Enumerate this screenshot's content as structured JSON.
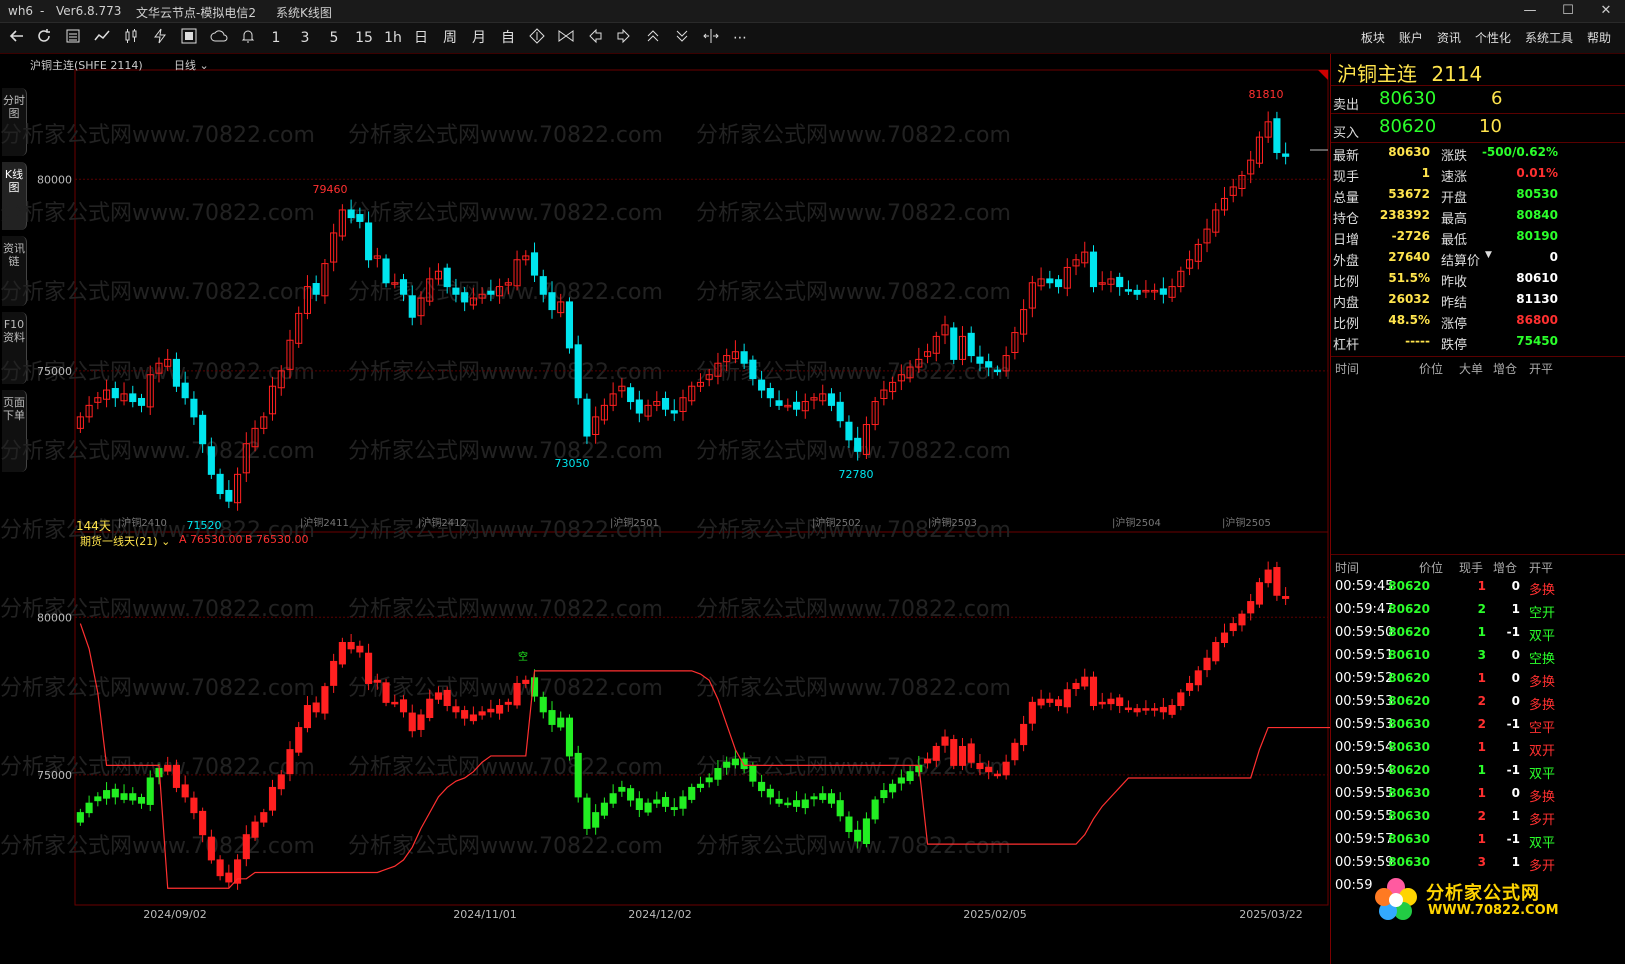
{
  "titlebar": {
    "app": "wh6",
    "version": "Ver6.8.773",
    "server": "文华云节点-模拟电信2",
    "view": "系统K线图",
    "controls": [
      "—",
      "☐",
      "✕"
    ]
  },
  "toolbar": {
    "icons": [
      "back-icon",
      "refresh-icon",
      "list-icon",
      "line-chart-icon",
      "candle-icon",
      "lightning-icon",
      "grid-icon",
      "cloud-icon",
      "bell-icon"
    ],
    "periods": [
      "1",
      "3",
      "5",
      "15",
      "1h",
      "日",
      "周",
      "月",
      "自"
    ],
    "menu": [
      "板块",
      "账户",
      "资讯",
      "个性化",
      "系统工具",
      "帮助"
    ]
  },
  "lefttabs": [
    {
      "label": "分时图",
      "active": false
    },
    {
      "label": "K线图",
      "active": true
    },
    {
      "label": "资讯链",
      "active": false
    },
    {
      "label": "F10资料",
      "active": false
    },
    {
      "label": "页面下单",
      "active": false
    }
  ],
  "chart": {
    "symbol_label": "沪铜主连(SHFE 2114)",
    "period_label": "日线",
    "days_label": "144天",
    "indicator_label": "期货一线天(21)",
    "indicator_a": "A 76530.00",
    "indicator_b": "B 76530.00",
    "watermark": "分析家公式网www.70822.com",
    "signal_label": "空",
    "colors": {
      "up": "#ff2020",
      "down": "#00e5ee",
      "ind_up": "#ff2020",
      "ind_down": "#22ee22",
      "line": "#ff3030",
      "grid": "#5a0000"
    }
  },
  "chart_data": [
    {
      "type": "candlestick",
      "title": "沪铜主连(SHFE 2114) 日线",
      "y_ticks": [
        80000,
        75000
      ],
      "ylim": [
        70900,
        82800
      ],
      "x_ticks": [
        "2024/09/02",
        "2024/11/01",
        "2024/12/02",
        "2025/02/05",
        "2025/03/22"
      ],
      "contract_labels": [
        "沪铜2410",
        "沪铜2411",
        "沪铜2412",
        "沪铜2501",
        "沪铜2502",
        "沪铜2503",
        "沪铜2504",
        "沪铜2505"
      ],
      "annotations": [
        "81810",
        "79460",
        "73050",
        "72780",
        "71520"
      ],
      "close_path": [
        73800,
        74100,
        74300,
        74500,
        74300,
        74400,
        74200,
        74100,
        74900,
        75200,
        75300,
        74600,
        74300,
        73800,
        73100,
        72300,
        71800,
        71600,
        72300,
        73100,
        73500,
        73800,
        74600,
        75000,
        75800,
        76500,
        77200,
        77000,
        77800,
        78600,
        79200,
        79000,
        78900,
        77900,
        78000,
        77300,
        77300,
        77000,
        76400,
        76900,
        77400,
        77600,
        77200,
        77000,
        76800,
        76900,
        77000,
        77000,
        77200,
        77300,
        77900,
        78000,
        77500,
        77000,
        76600,
        76800,
        75600,
        74300,
        73300,
        73800,
        74100,
        74400,
        74600,
        74200,
        73900,
        74100,
        74200,
        74000,
        73900,
        74300,
        74600,
        74700,
        74900,
        75200,
        75400,
        75500,
        75200,
        74800,
        74500,
        74300,
        74100,
        74100,
        74000,
        74200,
        74300,
        74400,
        74100,
        73700,
        73200,
        72900,
        73600,
        74200,
        74500,
        74700,
        74900,
        75100,
        75300,
        75500,
        75900,
        76200,
        75300,
        75900,
        75400,
        75200,
        75100,
        75000,
        75400,
        76000,
        76600,
        77300,
        77400,
        77300,
        77200,
        77700,
        77900,
        78100,
        77200,
        77300,
        77400,
        77200,
        77100,
        77000,
        77100,
        77100,
        77000,
        77200,
        77600,
        77900,
        78300,
        78700,
        79200,
        79500,
        79800,
        80100,
        80500,
        81100,
        81500,
        80700,
        80600
      ],
      "indicator": {
        "name": "期货一线天(21)",
        "A": 76530.0,
        "B": 76530.0,
        "line_path": [
          79800,
          79000,
          77600,
          75300,
          75300,
          75300,
          75300,
          75300,
          75300,
          75300,
          71400,
          71400,
          71400,
          71400,
          71400,
          71400,
          71400,
          71400,
          71700,
          71700,
          71900,
          71900,
          71900,
          71900,
          71900,
          71900,
          71900,
          71900,
          71900,
          71900,
          71900,
          71900,
          71900,
          71900,
          71900,
          72000,
          72100,
          72300,
          72700,
          73300,
          73800,
          74300,
          74600,
          74800,
          74900,
          75100,
          75400,
          75600,
          75600,
          75600,
          75600,
          75600,
          78300,
          78300,
          78300,
          78300,
          78300,
          78300,
          78300,
          78300,
          78300,
          78300,
          78300,
          78300,
          78300,
          78300,
          78300,
          78300,
          78300,
          78300,
          78300,
          78200,
          78000,
          77400,
          76600,
          75800,
          75300,
          75300,
          75300,
          75300,
          75300,
          75300,
          75300,
          75300,
          75300,
          75300,
          75300,
          75300,
          75300,
          75300,
          75300,
          75300,
          75300,
          75300,
          75300,
          75300,
          75300,
          72800,
          72800,
          72800,
          72800,
          72800,
          72800,
          72800,
          72800,
          72800,
          72800,
          72800,
          72800,
          72800,
          72800,
          72800,
          72800,
          72800,
          72800,
          73100,
          73600,
          74000,
          74300,
          74600,
          74900,
          74900,
          74900,
          74900,
          74900,
          74900,
          74900,
          74900,
          74900,
          74900,
          74900,
          74900,
          74900,
          74900,
          74900,
          75800,
          76500,
          76500,
          76500,
          76500,
          76500,
          76500,
          76500,
          76500,
          76500,
          76500,
          76500,
          76500
        ]
      }
    }
  ],
  "panel": {
    "name": "沪铜主连",
    "code": "2114",
    "sell_label": "卖出",
    "sell_price": "80630",
    "sell_vol": "6",
    "buy_label": "买入",
    "buy_price": "80620",
    "buy_vol": "10",
    "quotes": [
      {
        "l1": "最新",
        "v1": "80630",
        "c1": "yel",
        "l2": "涨跌",
        "v2": "-500/0.62%",
        "c2": "grn"
      },
      {
        "l1": "现手",
        "v1": "1",
        "c1": "yel",
        "l2": "速涨",
        "v2": "0.01%",
        "c2": "red"
      },
      {
        "l1": "总量",
        "v1": "53672",
        "c1": "yel",
        "l2": "开盘",
        "v2": "80530",
        "c2": "grn"
      },
      {
        "l1": "持仓",
        "v1": "238392",
        "c1": "yel",
        "l2": "最高",
        "v2": "80840",
        "c2": "grn"
      },
      {
        "l1": "日增",
        "v1": "-2726",
        "c1": "yel",
        "l2": "最低",
        "v2": "80190",
        "c2": "grn"
      },
      {
        "l1": "外盘",
        "v1": "27640",
        "c1": "yel",
        "l2": "结算价",
        "v2": "0",
        "c2": "wht"
      },
      {
        "l1": "比例",
        "v1": "51.5%",
        "c1": "yel",
        "l2": "昨收",
        "v2": "80610",
        "c2": "wht"
      },
      {
        "l1": "内盘",
        "v1": "26032",
        "c1": "yel",
        "l2": "昨结",
        "v2": "81130",
        "c2": "wht"
      },
      {
        "l1": "比例",
        "v1": "48.5%",
        "c1": "yel",
        "l2": "涨停",
        "v2": "86800",
        "c2": "red"
      },
      {
        "l1": "杠杆",
        "v1": "-----",
        "c1": "yel",
        "l2": "跌停",
        "v2": "75450",
        "c2": "grn"
      }
    ],
    "bigorder_headers": [
      "时间",
      "价位",
      "大单",
      "增仓",
      "开平"
    ],
    "tick_headers": [
      "时间",
      "价位",
      "现手",
      "增仓",
      "开平"
    ],
    "ticks": [
      {
        "time": "00:59:45",
        "price": "80620",
        "vol": "1",
        "vc": "red",
        "chg": "0",
        "type": "多换",
        "tc": "red"
      },
      {
        "time": "00:59:47",
        "price": "80620",
        "vol": "2",
        "vc": "grn",
        "chg": "1",
        "type": "空开",
        "tc": "grn"
      },
      {
        "time": "00:59:50",
        "price": "80620",
        "vol": "1",
        "vc": "grn",
        "chg": "-1",
        "type": "双平",
        "tc": "grn"
      },
      {
        "time": "00:59:51",
        "price": "80610",
        "vol": "3",
        "vc": "grn",
        "chg": "0",
        "type": "空换",
        "tc": "grn"
      },
      {
        "time": "00:59:52",
        "price": "80620",
        "vol": "1",
        "vc": "red",
        "chg": "0",
        "type": "多换",
        "tc": "red"
      },
      {
        "time": "00:59:53",
        "price": "80620",
        "vol": "2",
        "vc": "red",
        "chg": "0",
        "type": "多换",
        "tc": "red"
      },
      {
        "time": "00:59:53",
        "price": "80630",
        "vol": "2",
        "vc": "red",
        "chg": "-1",
        "type": "空平",
        "tc": "red"
      },
      {
        "time": "00:59:54",
        "price": "80630",
        "vol": "1",
        "vc": "red",
        "chg": "1",
        "type": "双开",
        "tc": "red"
      },
      {
        "time": "00:59:54",
        "price": "80620",
        "vol": "1",
        "vc": "grn",
        "chg": "-1",
        "type": "双平",
        "tc": "grn"
      },
      {
        "time": "00:59:55",
        "price": "80630",
        "vol": "1",
        "vc": "red",
        "chg": "0",
        "type": "多换",
        "tc": "red"
      },
      {
        "time": "00:59:55",
        "price": "80630",
        "vol": "2",
        "vc": "red",
        "chg": "1",
        "type": "多开",
        "tc": "red"
      },
      {
        "time": "00:59:57",
        "price": "80630",
        "vol": "1",
        "vc": "red",
        "chg": "-1",
        "type": "双平",
        "tc": "grn"
      },
      {
        "time": "00:59:59",
        "price": "80630",
        "vol": "3",
        "vc": "red",
        "chg": "1",
        "type": "多开",
        "tc": "red"
      },
      {
        "time": "00:59",
        "price": "",
        "vol": "",
        "vc": "red",
        "chg": "",
        "type": "",
        "tc": "red"
      }
    ],
    "logo_cn": "分析家公式网",
    "logo_url": "WWW.70822.COM"
  }
}
